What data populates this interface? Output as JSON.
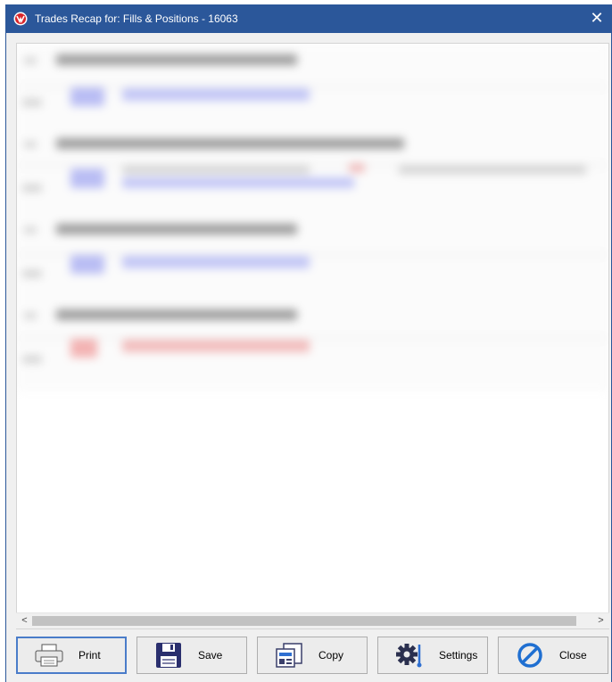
{
  "window": {
    "title": "Trades Recap for: Fills & Positions - 16063",
    "close_glyph": "✕"
  },
  "content": {
    "note": ""
  },
  "scrollbar": {
    "left_arrow": "<",
    "right_arrow": ">"
  },
  "buttons": [
    {
      "label": "Print",
      "icon": "printer-icon"
    },
    {
      "label": "Save",
      "icon": "floppy-disk-icon"
    },
    {
      "label": "Copy",
      "icon": "copy-icon"
    },
    {
      "label": "Settings",
      "icon": "gear-icon"
    },
    {
      "label": "Close",
      "icon": "prohibited-icon"
    }
  ],
  "colors": {
    "titlebar": "#2b579a",
    "buy_blue": "#5c6cf0",
    "sell_red": "#e84a4a",
    "close_icon_blue": "#1f6fd1",
    "save_icon_navy": "#2a2f6e"
  }
}
